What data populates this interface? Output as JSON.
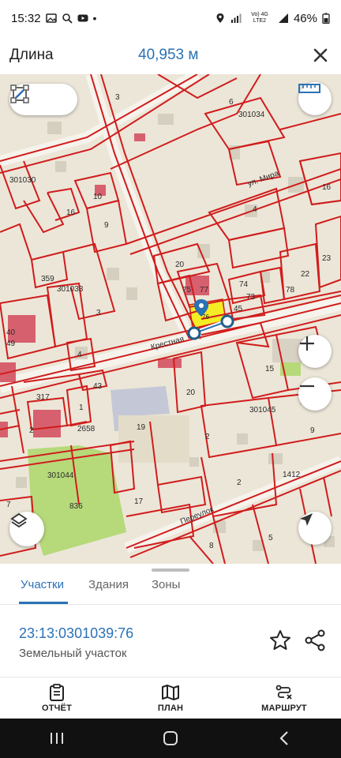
{
  "status_bar": {
    "time": "15:32",
    "network": "Vo) 4G LTE2",
    "battery": "46%"
  },
  "header": {
    "title": "Длина",
    "measure_value": "40,953 м"
  },
  "map": {
    "parcel_labels": [
      "301034",
      "301030",
      "301033",
      "301045",
      "301044",
      "1412"
    ],
    "lot_numbers": [
      "3",
      "6",
      "10",
      "16",
      "9",
      "4",
      "16",
      "23",
      "20",
      "74",
      "22",
      "78",
      "75",
      "77",
      "73",
      "45",
      "359",
      "3",
      "40",
      "49",
      "4",
      "15",
      "43",
      "20",
      "317",
      "1",
      "2658",
      "2",
      "19",
      "9",
      "2",
      "836",
      "17",
      "7",
      "8",
      "5",
      "2"
    ],
    "street_labels": [
      "Крестная",
      "ул. Мира",
      "Переулок"
    ],
    "selected_lot": "76"
  },
  "tabs": [
    {
      "label": "Участки"
    },
    {
      "label": "Здания"
    },
    {
      "label": "Зоны"
    }
  ],
  "parcel": {
    "cadastral_number": "23:13:0301039:76",
    "type": "Земельный участок"
  },
  "bottom_nav": {
    "report": "ОТЧЁТ",
    "plan": "ПЛАН",
    "route": "МАРШРУТ"
  },
  "colors": {
    "accent": "#2a72b5",
    "boundary": "#d01c1c",
    "highlight": "#f4ec24",
    "green_area": "#b6d97a"
  }
}
